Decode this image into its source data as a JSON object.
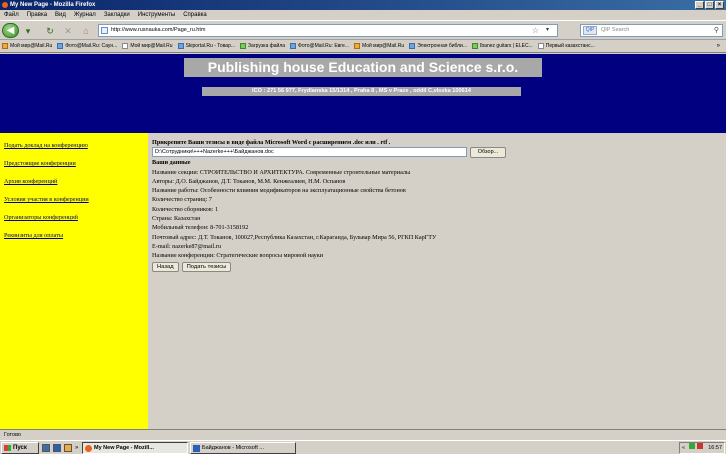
{
  "window": {
    "title": "My New Page - Mozilla Firefox",
    "controls": [
      "_",
      "□",
      "×"
    ]
  },
  "menu": [
    "Файл",
    "Правка",
    "Вид",
    "Журнал",
    "Закладки",
    "Инструменты",
    "Справка"
  ],
  "nav": {
    "url": "http://www.rusnauka.com/Page_ru.htm",
    "search_placeholder": "QIP Search",
    "search_engine_label": "QIP"
  },
  "bookmarks": [
    "Мой мир@Mail.Ru",
    "Фото@Mail.Ru: Саун...",
    "Мой мир@Mail.Ru",
    "Skiportal.Ru - Товар...",
    "Загрузка файла",
    "Фото@Mail.Ru: Евге...",
    "Мой мир@Mail.Ru",
    "Электронная библи...",
    "Ibanez guitars | ELEC...",
    "Первый казахстанс..."
  ],
  "bookmarks_more": "»",
  "page": {
    "site_title": "Publishing house Education and Science s.r.o.",
    "site_subtitle": "ICO : 271 56 977, Frydlanska 15/1314 , Praha 8 , MS v Praze , oddil C,vlozka 100614",
    "sidebar_links": [
      "Подать доклад на конференцию",
      "Предстоящие конференции",
      "Архив конференций",
      "Условия участия в конференции",
      "Организаторы конференций",
      "Реквизиты для оплаты"
    ],
    "instruction": "Прикрепите Ваши тезисы в виде файла Microsoft Word с расширением .doc или . rtf .",
    "file_path": "D:\\Сотрудники\\+++Nazerke+++\\Байджанов.doc",
    "browse_label": "Обзор...",
    "data_heading": "Ваши данные",
    "details": [
      "Название секции: СТРОИТЕЛЬСТВО И АРХИТЕКТУРА. Современные строительные материалы",
      "Авторы: Д.О. Байджанов, Д.Т. Токанов, М.М. Кенжеалиев, Н.М. Оспанов",
      "Название работы: Особенности влияния модификаторов на эксплуатационные свойства бетонов",
      "Количество страниц: 7",
      "Количество сборников: 1",
      "Страна: Казахстан",
      "Мобильный телефон: 8-701-3158192",
      "Почтовый адрес: Д.Т. Токанов, 100027,Республика Казахстан, г.Караганда, Бульвар Мира 56, РГКП КарГТУ",
      "E-mail: nazerke87@mail.ru",
      "Название конференции: Стратегические вопросы мировой науки"
    ],
    "back_label": "Назад",
    "submit_label": "Подать тезисы"
  },
  "status": "Готово",
  "taskbar": {
    "start_label": "Пуск",
    "chevron": "»",
    "tasks": [
      "My New Page - Mozill...",
      "Байджанов - Microsoft ..."
    ],
    "tray_prefix": "«",
    "time": "16:57"
  },
  "colors": {
    "header_bg": "#000080",
    "sidebar_bg": "#ffff00",
    "content_bg": "#d4d0c8",
    "title_box": "#a8a8a8"
  }
}
